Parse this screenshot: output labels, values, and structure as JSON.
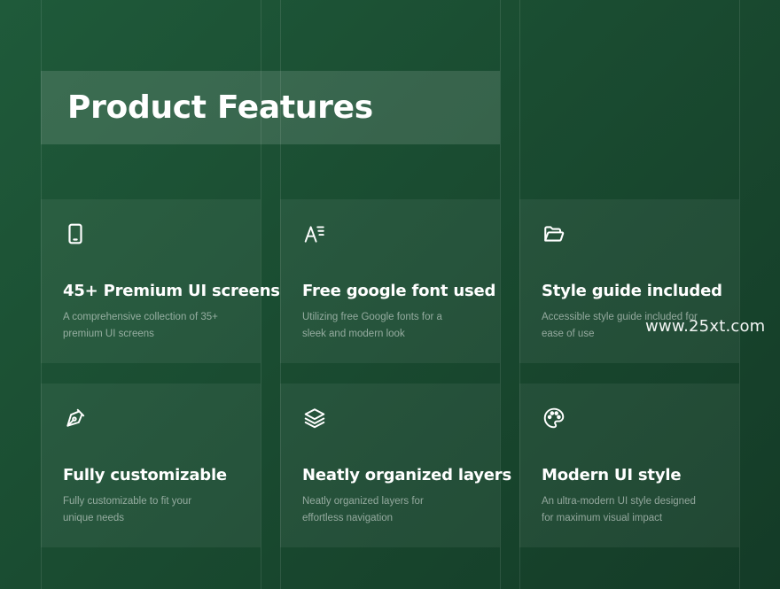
{
  "header": {
    "title": "Product Features"
  },
  "features": [
    {
      "title": "45+ Premium UI screens",
      "description": "A comprehensive collection of 35+ premium UI screens",
      "icon": "smartphone-icon"
    },
    {
      "title": "Free google font used",
      "description": "Utilizing free Google fonts for a sleek and modern look",
      "icon": "font-icon"
    },
    {
      "title": "Style guide included",
      "description": "Accessible style guide included for ease of use",
      "icon": "folder-open-icon"
    },
    {
      "title": "Fully customizable",
      "description": "Fully customizable to fit your unique needs",
      "icon": "pen-tool-icon"
    },
    {
      "title": "Neatly organized layers",
      "description": "Neatly organized layers for effortless navigation",
      "icon": "layers-icon"
    },
    {
      "title": "Modern UI style",
      "description": "An ultra-modern UI style designed for maximum visual impact",
      "icon": "palette-icon"
    }
  ],
  "watermark": {
    "text": "www.25xt.com"
  },
  "colors": {
    "background": "#1a4c31",
    "accent_text": "#ffffff"
  }
}
